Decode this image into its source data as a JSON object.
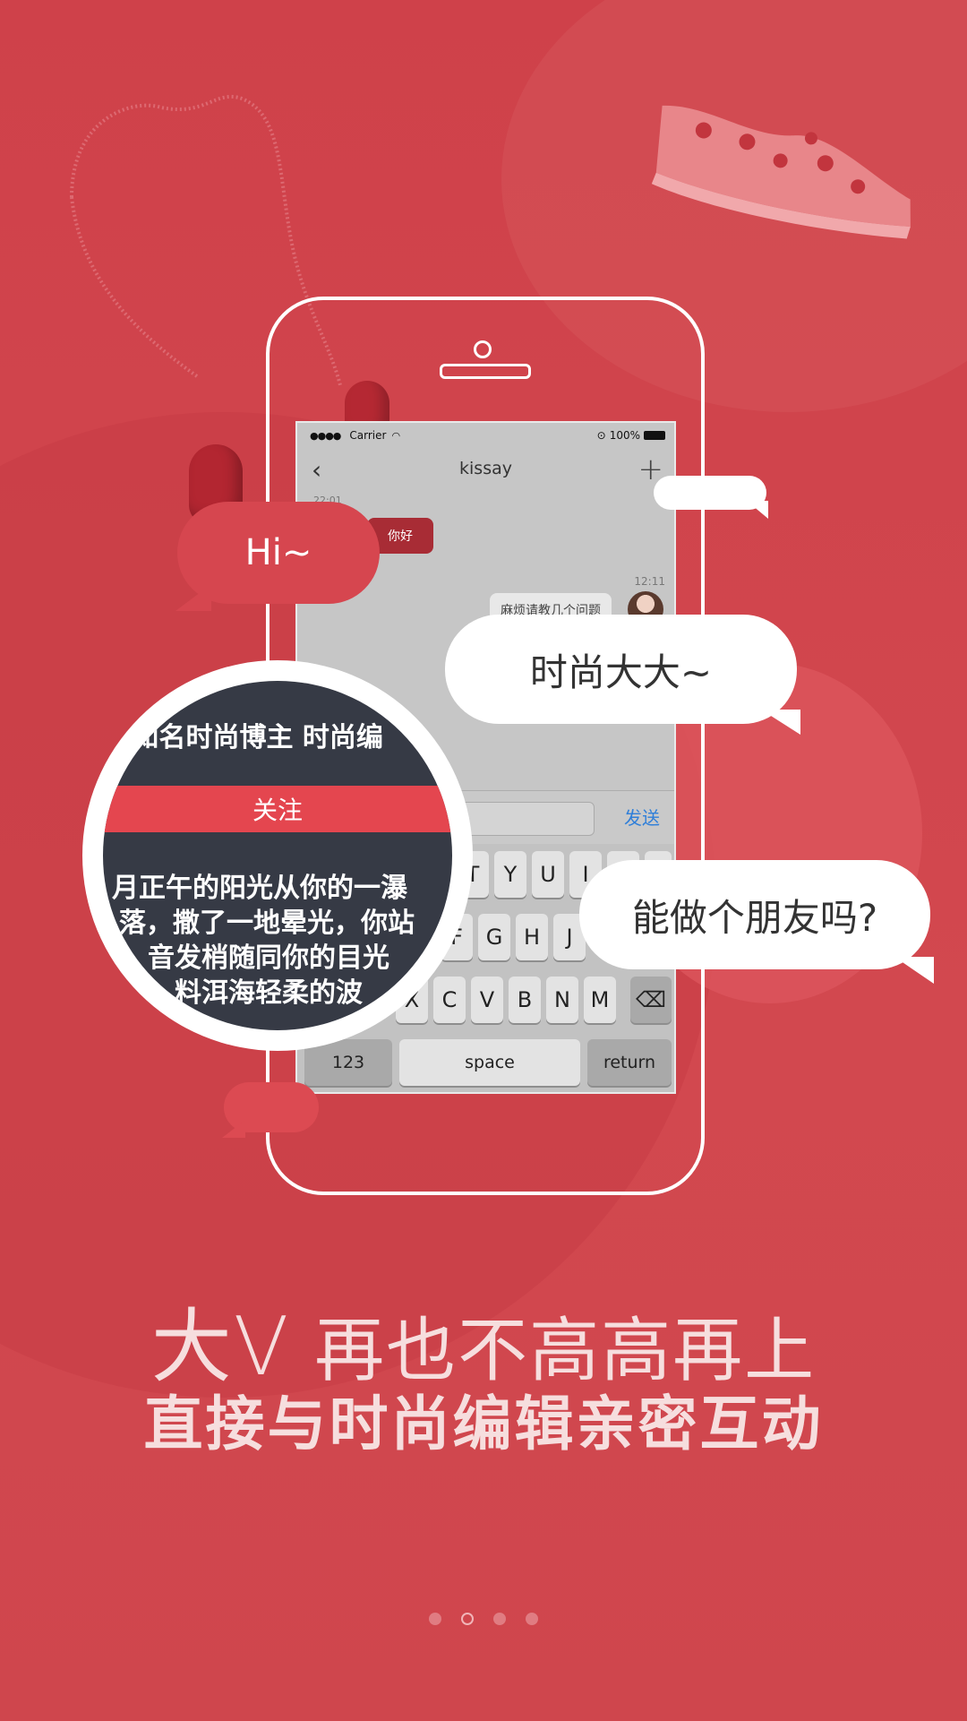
{
  "status_bar": {
    "signal": "●●●●",
    "carrier": "Carrier",
    "battery": "100%"
  },
  "chat": {
    "title": "kissay",
    "timestamp_1": "22:01",
    "message_in": "你好",
    "timestamp_2": "12:11",
    "message_out": "麻烦请教几个问题",
    "send_label": "发送"
  },
  "keyboard": {
    "row1": [
      "T",
      "Y",
      "U",
      "I"
    ],
    "row2": [
      "F",
      "G",
      "H",
      "J"
    ],
    "row3": [
      "X",
      "C",
      "V",
      "B",
      "N",
      "M"
    ],
    "numbers": "123",
    "space": "space",
    "return": "return",
    "delete_icon": "⌫"
  },
  "bubbles": {
    "hi": "Hi~",
    "fashion": "时尚大大~",
    "friend": "能做个朋友吗?"
  },
  "magnifier": {
    "profile_line": "人 知名时尚博主 时尚编",
    "follow_label": "关注",
    "bio_lines": [
      "月正午的阳光从你的一瀑",
      "落，撒了一地晕光，你站",
      "音发梢随同你的目光",
      "料洱海轻柔的波"
    ]
  },
  "headline": {
    "big_v": "大V",
    "line1_rest": "再也不高高再上",
    "line2": "直接与时尚编辑亲密互动"
  },
  "pager": {
    "count": 4,
    "active_index": 1
  },
  "colors": {
    "background": "#d0434b",
    "accent": "#e4464f",
    "send_blue": "#2f7fd9"
  }
}
